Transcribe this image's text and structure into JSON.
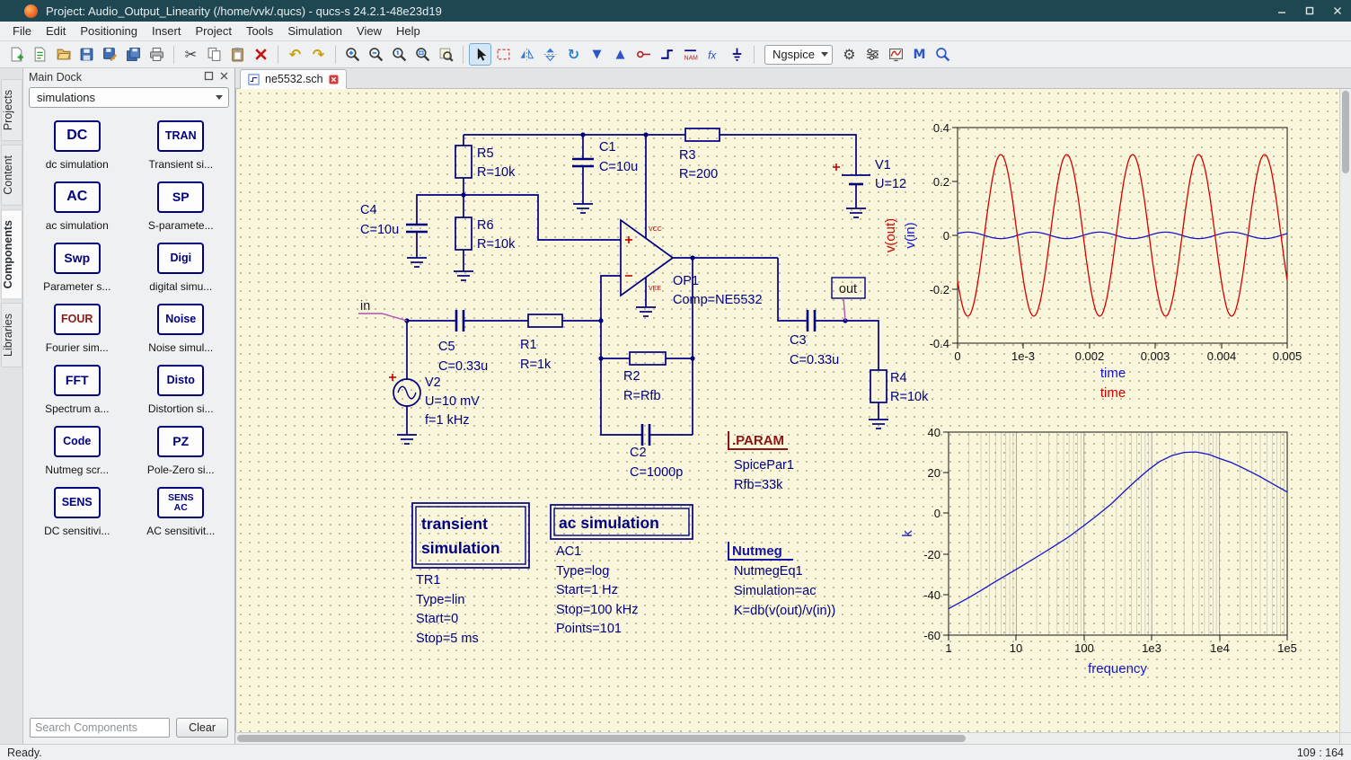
{
  "window": {
    "title": "Project: Audio_Output_Linearity (/home/vvk/.qucs) - qucs-s 24.2.1-48e23d19"
  },
  "menu": {
    "items": [
      "File",
      "Edit",
      "Positioning",
      "Insert",
      "Project",
      "Tools",
      "Simulation",
      "View",
      "Help"
    ]
  },
  "toolbar": {
    "simulator": "Ngspice"
  },
  "icons": {
    "cut": "✂",
    "undo": "↶",
    "redo": "↷",
    "rotate": "↻",
    "move_down": "▼",
    "move_up": "▲",
    "gear": "⚙",
    "m_tool": "M",
    "equation": "fx",
    "wire_label": "NAME"
  },
  "colors": {
    "wire": "#000080",
    "canvas_background": "#f9f6dc",
    "curve_vout": "#d40000",
    "curve_vin": "#1616c8",
    "param_block_accent": "#8b1515",
    "nutmeg_block_accent": "#1515a0",
    "four_icon_text": "#8b1a1a",
    "titlebar_background": "#1e4752"
  },
  "dock": {
    "title": "Main Dock",
    "category": "simulations",
    "side_tabs": [
      "Projects",
      "Content",
      "Components",
      "Libraries"
    ],
    "items": [
      {
        "icon": "DC",
        "label": "dc simulation"
      },
      {
        "icon": "TRAN",
        "label": "Transient si..."
      },
      {
        "icon": "AC",
        "label": "ac simulation"
      },
      {
        "icon": "SP",
        "label": "S-paramete..."
      },
      {
        "icon": "Swp",
        "label": "Parameter s..."
      },
      {
        "icon": "Digi",
        "label": "digital simu..."
      },
      {
        "icon": "FOUR",
        "label": "Fourier sim..."
      },
      {
        "icon": "Noise",
        "label": "Noise simul..."
      },
      {
        "icon": "FFT",
        "label": "Spectrum a..."
      },
      {
        "icon": "Disto",
        "label": "Distortion si..."
      },
      {
        "icon": "Code",
        "label": "Nutmeg scr..."
      },
      {
        "icon": "PZ",
        "label": "Pole-Zero si..."
      },
      {
        "icon": "SENS",
        "label": "DC sensitivi..."
      },
      {
        "icon": "SENS",
        "icon2": "AC",
        "label": "AC sensitivit..."
      }
    ],
    "search_placeholder": "Search Components",
    "clear_label": "Clear"
  },
  "editor": {
    "tab_label": "ne5532.sch"
  },
  "statusbar": {
    "left": "Ready.",
    "right": "109 : 164"
  },
  "schematic": {
    "components": {
      "R5": {
        "name": "R5",
        "value": "R=10k"
      },
      "R6": {
        "name": "R6",
        "value": "R=10k"
      },
      "R3": {
        "name": "R3",
        "value": "R=200"
      },
      "R1": {
        "name": "R1",
        "value": "R=1k"
      },
      "R2": {
        "name": "R2",
        "value": "R=Rfb"
      },
      "R4": {
        "name": "R4",
        "value": "R=10k"
      },
      "C1": {
        "name": "C1",
        "value": "C=10u"
      },
      "C2": {
        "name": "C2",
        "value": "C=1000p"
      },
      "C3": {
        "name": "C3",
        "value": "C=0.33u"
      },
      "C4": {
        "name": "C4",
        "value": "C=10u"
      },
      "C5": {
        "name": "C5",
        "value": "C=0.33u"
      },
      "V1": {
        "name": "V1",
        "value": "U=12"
      },
      "V2": {
        "name": "V2",
        "value": "U=10 mV",
        "value2": "f=1 kHz"
      },
      "OP1": {
        "name": "OP1",
        "value": "Comp=NE5532",
        "vcc": "VCC",
        "vee": "VEE"
      }
    },
    "node_labels": {
      "in": "in",
      "out": "out"
    },
    "param_block": {
      "title": ".PARAM",
      "name": "SpicePar1",
      "line1": "Rfb=33k"
    },
    "nutmeg_block": {
      "title": "Nutmeg",
      "name": "NutmegEq1",
      "line1": "Simulation=ac",
      "line2": "K=db(v(out)/v(in))"
    },
    "transient_block": {
      "title_line1": "transient",
      "title_line2": "simulation",
      "name": "TR1",
      "line1": "Type=lin",
      "line2": "Start=0",
      "line3": "Stop=5 ms"
    },
    "ac_block": {
      "title": "ac simulation",
      "name": "AC1",
      "line1": "Type=log",
      "line2": "Start=1 Hz",
      "line3": "Stop=100 kHz",
      "line4": "Points=101"
    }
  },
  "chart_data": [
    {
      "type": "line",
      "xlabel": "time",
      "ylabels": [
        "v(out)",
        "v(in)"
      ],
      "x_range": [
        0,
        0.005
      ],
      "y_range": [
        -0.4,
        0.4
      ],
      "x_ticks": [
        "0",
        "1e-3",
        "0.002",
        "0.003",
        "0.004",
        "0.005"
      ],
      "y_ticks": [
        "0.4",
        "0.2",
        "0",
        "-0.2",
        "-0.4"
      ],
      "grid": false,
      "legend_position": "none",
      "series": [
        {
          "name": "v(out)",
          "color": "#d40000",
          "waveform": "sine",
          "amplitude": -0.3,
          "frequency_hz": 1000,
          "phase_deg": 34,
          "offset": 0
        },
        {
          "name": "v(in)",
          "color": "#1616c8",
          "waveform": "sine",
          "amplitude": 0.012,
          "frequency_hz": 1000,
          "phase_deg": 34,
          "offset": 0
        }
      ]
    },
    {
      "type": "line",
      "xlabel": "frequency",
      "ylabel": "k",
      "x_scale": "log",
      "x_range": [
        1,
        100000
      ],
      "y_range": [
        -60,
        40
      ],
      "x_ticks": [
        "1",
        "10",
        "100",
        "1e3",
        "1e4",
        "1e5"
      ],
      "y_ticks": [
        "40",
        "20",
        "0",
        "-20",
        "-40",
        "-60"
      ],
      "grid": true,
      "legend_position": "none",
      "series": [
        {
          "name": "K",
          "color": "#1616c8",
          "points": [
            [
              1,
              -47
            ],
            [
              2,
              -41.5
            ],
            [
              3,
              -38
            ],
            [
              5,
              -33.5
            ],
            [
              8,
              -29.5
            ],
            [
              12,
              -26
            ],
            [
              20,
              -21.5
            ],
            [
              35,
              -16.5
            ],
            [
              60,
              -11.5
            ],
            [
              100,
              -6
            ],
            [
              150,
              -1.5
            ],
            [
              250,
              4.5
            ],
            [
              400,
              11
            ],
            [
              600,
              16.5
            ],
            [
              900,
              21.5
            ],
            [
              1300,
              25.5
            ],
            [
              2000,
              28.5
            ],
            [
              3000,
              30
            ],
            [
              4500,
              30.2
            ],
            [
              7000,
              29
            ],
            [
              10000,
              27
            ],
            [
              15000,
              25
            ],
            [
              25000,
              21.5
            ],
            [
              40000,
              18
            ],
            [
              65000,
              14
            ],
            [
              100000,
              10.5
            ]
          ]
        }
      ]
    }
  ]
}
